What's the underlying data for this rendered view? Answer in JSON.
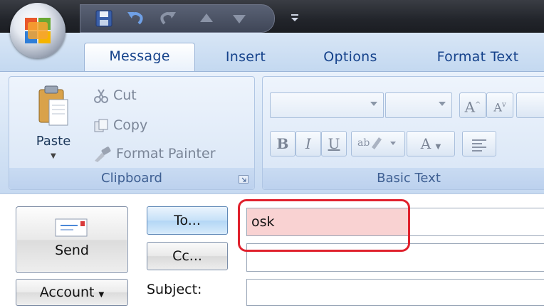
{
  "ribbon_tabs": [
    "Message",
    "Insert",
    "Options",
    "Format Text"
  ],
  "clipboard": {
    "paste": "Paste",
    "cut": "Cut",
    "copy": "Copy",
    "format_painter": "Format Painter",
    "group_label": "Clipboard"
  },
  "basic_text": {
    "group_label": "Basic Text",
    "bold": "B",
    "italic": "I",
    "underline": "U",
    "grow_font": "A",
    "shrink_font": "A",
    "font_color": "A"
  },
  "compose": {
    "send": "Send",
    "to_button": "To...",
    "cc_button": "Cc...",
    "account_button": "Account",
    "subject_label": "Subject:",
    "to_value": "osk",
    "cc_value": "",
    "subject_value": ""
  },
  "colors": {
    "highlight_box": "#e0212d",
    "to_field_fill": "#f9d2d2"
  }
}
